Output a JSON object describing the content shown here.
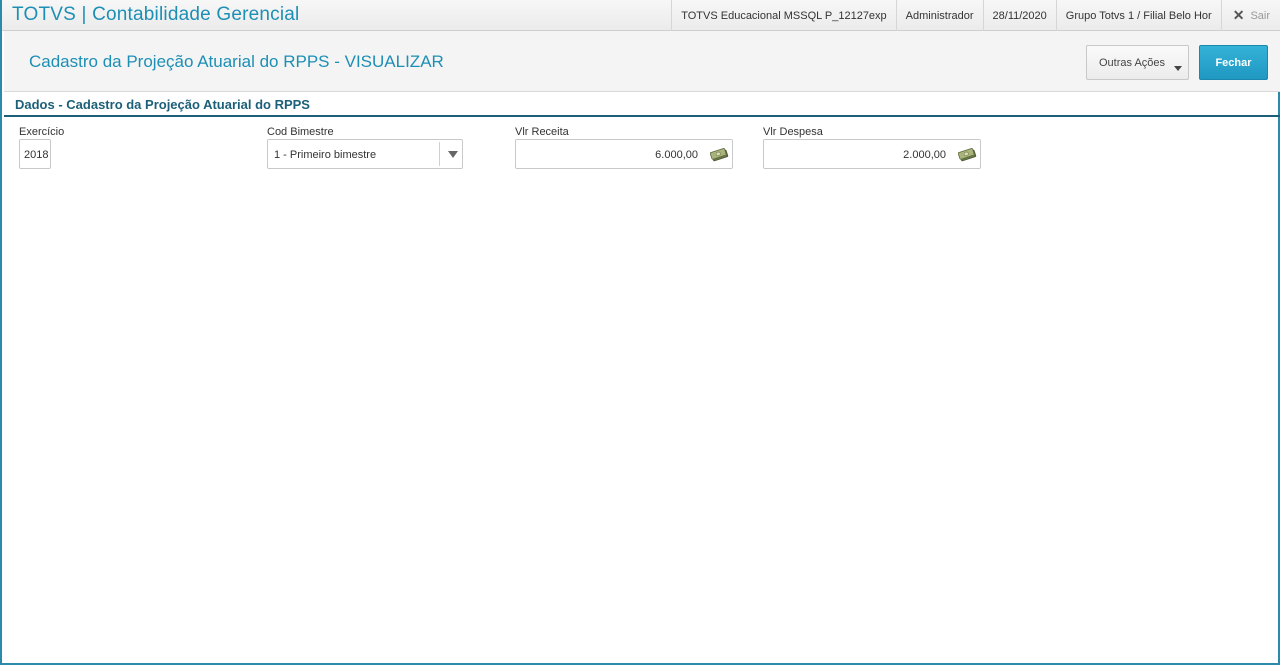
{
  "topbar": {
    "app_title": "TOTVS | Contabilidade Gerencial",
    "environment": "TOTVS Educacional MSSQL P_12127exp",
    "user": "Administrador",
    "date": "28/11/2020",
    "branch": "Grupo Totvs 1 / Filial Belo Hor",
    "exit_label": "Sair"
  },
  "header": {
    "page_title": "Cadastro da Projeção Atuarial do RPPS - VISUALIZAR",
    "other_actions_label": "Outras Ações",
    "close_label": "Fechar"
  },
  "section": {
    "title": "Dados - Cadastro da Projeção Atuarial do RPPS"
  },
  "fields": {
    "exercicio": {
      "label": "Exercício",
      "value": "2018"
    },
    "cod_bimestre": {
      "label": "Cod Bimestre",
      "value": "1 - Primeiro bimestre"
    },
    "vlr_receita": {
      "label": "Vlr Receita",
      "value": "6.000,00"
    },
    "vlr_despesa": {
      "label": "Vlr Despesa",
      "value": "2.000,00"
    }
  },
  "icons": {
    "close": "close-icon",
    "money": "money-icon",
    "dropdown": "chevron-down-icon"
  },
  "colors": {
    "accent": "#1d8fb5",
    "section": "#1c5f78",
    "primary_button": "#1f98c2"
  }
}
